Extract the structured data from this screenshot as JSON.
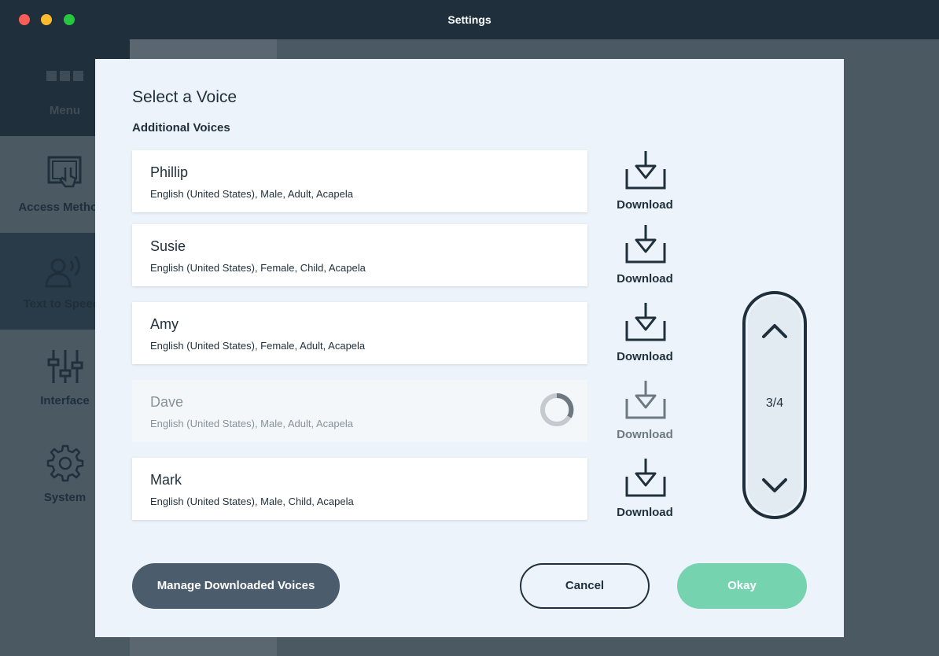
{
  "window": {
    "title": "Settings"
  },
  "sidebar": {
    "items": [
      {
        "label": "Menu",
        "icon": "menu-grid-icon"
      },
      {
        "label": "Access Methods",
        "icon": "touch-screen-icon"
      },
      {
        "label": "Text to Speech",
        "icon": "speaking-person-icon"
      },
      {
        "label": "Interface",
        "icon": "sliders-icon"
      },
      {
        "label": "System",
        "icon": "gear-icon"
      }
    ]
  },
  "dialog": {
    "title": "Select a Voice",
    "section": "Additional Voices",
    "voices": [
      {
        "name": "Phillip",
        "details": "English (United States), Male, Adult, Acapela",
        "action": "Download",
        "state": "available"
      },
      {
        "name": "Susie",
        "details": "English (United States), Female, Child, Acapela",
        "action": "Download",
        "state": "available"
      },
      {
        "name": "Amy",
        "details": "English (United States), Female, Adult, Acapela",
        "action": "Download",
        "state": "available"
      },
      {
        "name": "Dave",
        "details": "English (United States), Male, Adult, Acapela",
        "action": "Download",
        "state": "downloading"
      },
      {
        "name": "Mark",
        "details": "English (United States), Male, Child, Acapela",
        "action": "Download",
        "state": "available"
      }
    ],
    "pager": {
      "count": "3/4",
      "up_icon": "chevron-up-icon",
      "down_icon": "chevron-down-icon"
    },
    "buttons": {
      "manage": "Manage Downloaded Voices",
      "cancel": "Cancel",
      "okay": "Okay"
    }
  },
  "colors": {
    "titlebar": "#1f2f3b",
    "dialog_bg": "#ecf3fa",
    "text_dark": "#1f2f3b",
    "okay_green": "#76d3af",
    "manage_slate": "#4b5d6c"
  }
}
